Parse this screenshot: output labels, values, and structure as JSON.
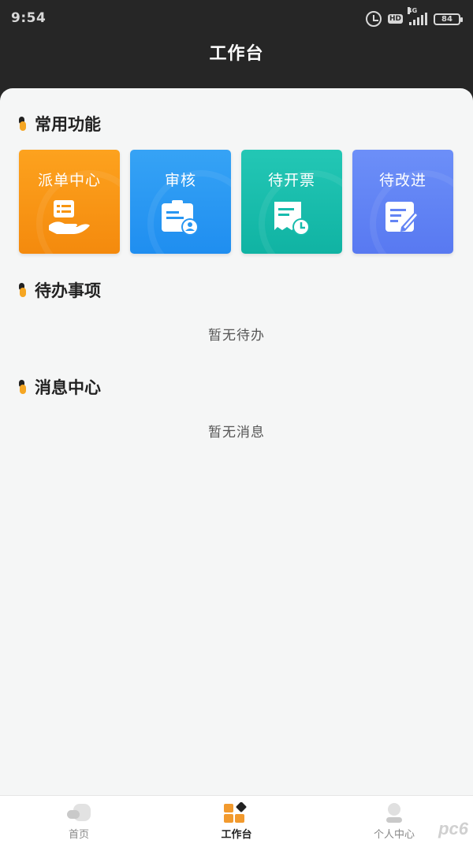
{
  "status_bar": {
    "time": "9:54",
    "network": "4G",
    "hd": "HD",
    "battery": "84"
  },
  "header": {
    "title": "工作台"
  },
  "sections": {
    "common": {
      "title": "常用功能",
      "tiles": [
        {
          "label": "派单中心",
          "icon": "hand-card-icon",
          "color": "#f7950f"
        },
        {
          "label": "审核",
          "icon": "badge-person-icon",
          "color": "#2896f2"
        },
        {
          "label": "待开票",
          "icon": "receipt-clock-icon",
          "color": "#17bcad"
        },
        {
          "label": "待改进",
          "icon": "edit-document-icon",
          "color": "#6384f4"
        }
      ]
    },
    "todo": {
      "title": "待办事项",
      "empty": "暂无待办"
    },
    "messages": {
      "title": "消息中心",
      "empty": "暂无消息"
    }
  },
  "bottom_nav": {
    "items": [
      {
        "label": "首页",
        "icon": "home-bubble-icon",
        "active": false
      },
      {
        "label": "工作台",
        "icon": "workbench-grid-icon",
        "active": true
      },
      {
        "label": "个人中心",
        "icon": "person-icon",
        "active": false
      }
    ]
  },
  "watermark": "pc6",
  "colors": {
    "accent": "#f5a623",
    "header_bg": "#262626",
    "content_bg": "#f5f6f6"
  }
}
